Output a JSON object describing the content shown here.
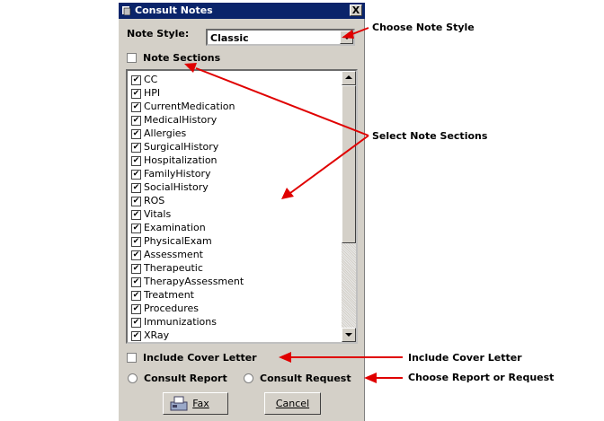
{
  "window": {
    "title": "Consult Notes",
    "close_label": "X"
  },
  "note_style": {
    "label": "Note Style:",
    "value": "Classic"
  },
  "note_sections": {
    "label": "Note Sections",
    "checked": false,
    "items": [
      {
        "label": "CC",
        "checked": true
      },
      {
        "label": "HPI",
        "checked": true
      },
      {
        "label": "CurrentMedication",
        "checked": true
      },
      {
        "label": "MedicalHistory",
        "checked": true
      },
      {
        "label": "Allergies",
        "checked": true
      },
      {
        "label": "SurgicalHistory",
        "checked": true
      },
      {
        "label": "Hospitalization",
        "checked": true
      },
      {
        "label": "FamilyHistory",
        "checked": true
      },
      {
        "label": "SocialHistory",
        "checked": true
      },
      {
        "label": "ROS",
        "checked": true
      },
      {
        "label": "Vitals",
        "checked": true
      },
      {
        "label": "Examination",
        "checked": true
      },
      {
        "label": "PhysicalExam",
        "checked": true
      },
      {
        "label": "Assessment",
        "checked": true
      },
      {
        "label": "Therapeutic",
        "checked": true
      },
      {
        "label": "TherapyAssessment",
        "checked": true
      },
      {
        "label": "Treatment",
        "checked": true
      },
      {
        "label": "Procedures",
        "checked": true
      },
      {
        "label": "Immunizations",
        "checked": true
      },
      {
        "label": "XRay",
        "checked": true
      }
    ]
  },
  "cover_letter": {
    "label": "Include Cover Letter",
    "checked": false
  },
  "report_type": {
    "report_label": "Consult Report",
    "request_label": "Consult Request",
    "selected": ""
  },
  "buttons": {
    "fax": "Fax",
    "cancel": "Cancel"
  },
  "annotations": {
    "note_style": "Choose Note Style",
    "note_sections": "Select Note Sections",
    "cover_letter": "Include Cover Letter",
    "report_request": "Choose Report or Request"
  },
  "colors": {
    "dialog_bg": "#d4d0c8",
    "titlebar": "#0a246a",
    "arrow": "#e00000"
  },
  "icons": {
    "title": "notes-icon",
    "fax": "fax-icon"
  }
}
